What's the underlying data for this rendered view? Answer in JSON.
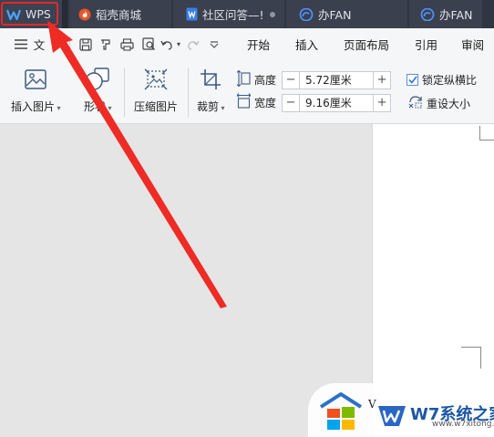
{
  "tabs": [
    {
      "label": "WPS",
      "icon": "wps-logo-icon"
    },
    {
      "label": "稻壳商城",
      "icon": "docer-flame-icon"
    },
    {
      "label": "社区问答—!",
      "icon": "writer-doc-icon"
    },
    {
      "label": "办FAN",
      "icon": "cloud-icon"
    },
    {
      "label": "办FAN",
      "icon": "cloud-icon"
    }
  ],
  "quick": {
    "file_label": "文",
    "icons": [
      "hamburger-icon",
      "save-icon",
      "format-painter-icon",
      "print-icon",
      "print-preview-icon",
      "undo-icon",
      "redo-icon",
      "customize-icon"
    ]
  },
  "menu": [
    "开始",
    "插入",
    "页面布局",
    "引用",
    "审阅"
  ],
  "ribbon": {
    "insert_picture": "插入图片",
    "shape": "形状",
    "compress": "压缩图片",
    "crop": "裁剪",
    "height_label": "高度",
    "height_value": "5.72厘米",
    "width_label": "宽度",
    "width_value": "9.16厘米",
    "lock_ratio": "锁定纵横比",
    "lock_ratio_checked": true,
    "reset_size": "重设大小"
  },
  "watermark": {
    "title": "W7系统之家",
    "url": "www.w7xitong.com",
    "letter": "V"
  },
  "colors": {
    "tabbar": "#2f3542",
    "highlight": "#e02a2a",
    "arrow": "#ee2b24",
    "accent": "#2d7be5"
  }
}
